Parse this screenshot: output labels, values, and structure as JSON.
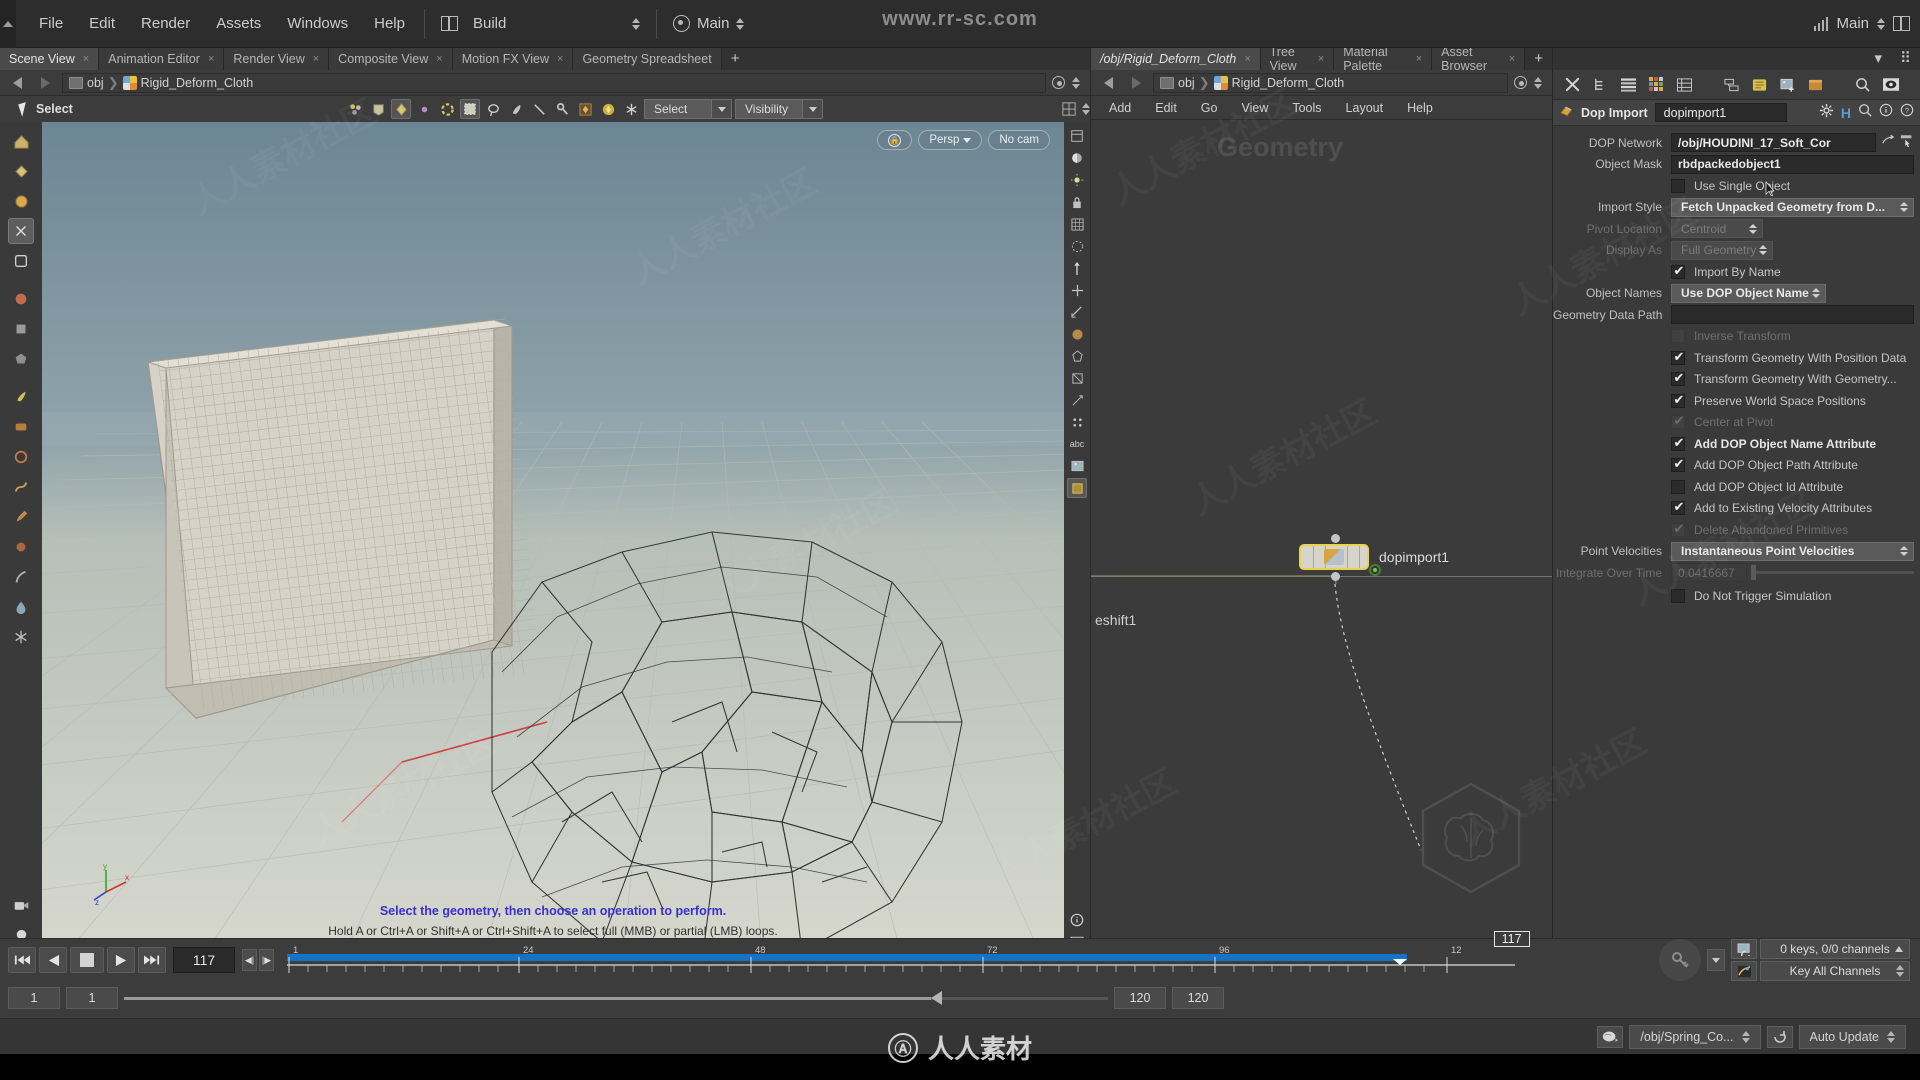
{
  "watermarks": {
    "top": "www.rr-sc.com",
    "bottom": "人人素材",
    "tile": "人人素材社区"
  },
  "menubar": {
    "items": [
      "File",
      "Edit",
      "Render",
      "Assets",
      "Windows",
      "Help"
    ],
    "desktop_label": "Build",
    "shelf_label": "Main",
    "right_label": "Main"
  },
  "scene_view": {
    "tabs": [
      {
        "label": "Scene View",
        "active": true,
        "closable": true
      },
      {
        "label": "Animation Editor",
        "active": false,
        "closable": true
      },
      {
        "label": "Render View",
        "active": false,
        "closable": true
      },
      {
        "label": "Composite View",
        "active": false,
        "closable": true
      },
      {
        "label": "Motion FX View",
        "active": false,
        "closable": true
      },
      {
        "label": "Geometry Spreadsheet",
        "active": false,
        "closable": true
      }
    ],
    "tab_add": "+",
    "path": {
      "root": "obj",
      "node": "Rigid_Deform_Cloth"
    },
    "toolbar": {
      "mode_label": "Select",
      "select_combo": "Select",
      "visibility_combo": "Visibility"
    },
    "badges": {
      "lock": "lock-icon",
      "view": "Persp",
      "camera": "No cam"
    },
    "hud": {
      "line1": "Select the geometry, then choose an operation to perform.",
      "line2": "Hold A or Ctrl+A or Shift+A or Ctrl+Shift+A to select full (MMB) or partial (LMB) loops."
    },
    "gnomon": {
      "x": "x",
      "y": "y",
      "z": "z"
    }
  },
  "network_editor": {
    "tabs": [
      {
        "label": "/obj/Rigid_Deform_Cloth",
        "active": true,
        "closable": true
      },
      {
        "label": "Tree View",
        "active": false,
        "closable": true
      },
      {
        "label": "Material Palette",
        "active": false,
        "closable": true
      },
      {
        "label": "Asset Browser",
        "active": false,
        "closable": true
      }
    ],
    "tab_add": "+",
    "path": {
      "root": "obj",
      "node": "Rigid_Deform_Cloth"
    },
    "menu": [
      "Add",
      "Edit",
      "Go",
      "View",
      "Tools",
      "Layout",
      "Help"
    ],
    "context_label": "Geometry",
    "nodes": [
      {
        "name": "dopimport1",
        "selected": true
      },
      {
        "name": "eshift1",
        "selected": false
      }
    ]
  },
  "parameters": {
    "node_type": "Dop Import",
    "node_name": "dopimport1",
    "rows": [
      {
        "kind": "field",
        "label": "DOP Network",
        "value": "/obj/HOUDINI_17_Soft_Cor",
        "dim": false
      },
      {
        "kind": "field",
        "label": "Object Mask",
        "value": "rbdpackedobject1",
        "dim": false
      },
      {
        "kind": "checkbox",
        "label": "Use Single Object",
        "checked": false,
        "dim": false
      },
      {
        "kind": "menu",
        "label": "Import Style",
        "value": "Fetch Unpacked Geometry from D...",
        "dim": false
      },
      {
        "kind": "menu",
        "label": "Pivot Location",
        "value": "Centroid",
        "dim": true
      },
      {
        "kind": "menu",
        "label": "Display As",
        "value": "Full Geometry",
        "dim": true
      },
      {
        "kind": "checkbox",
        "label": "Import By Name",
        "checked": true,
        "dim": false
      },
      {
        "kind": "menu",
        "label": "Object Names",
        "value": "Use DOP Object Name",
        "dim": false
      },
      {
        "kind": "field",
        "label": "Geometry Data Path",
        "value": "",
        "dim": false
      },
      {
        "kind": "checkbox",
        "label": "Inverse Transform",
        "checked": false,
        "dim": true
      },
      {
        "kind": "checkbox",
        "label": "Transform Geometry With Position Data",
        "checked": true,
        "dim": false
      },
      {
        "kind": "checkbox",
        "label": "Transform Geometry With Geometry...",
        "checked": true,
        "dim": false
      },
      {
        "kind": "checkbox",
        "label": "Preserve World Space Positions",
        "checked": true,
        "dim": false
      },
      {
        "kind": "checkbox",
        "label": "Center at Pivot",
        "checked": true,
        "dim": true
      },
      {
        "kind": "checkbox",
        "label": "Add DOP Object Name Attribute",
        "checked": true,
        "dim": false,
        "bold": true
      },
      {
        "kind": "checkbox",
        "label": "Add DOP Object Path Attribute",
        "checked": true,
        "dim": false
      },
      {
        "kind": "checkbox",
        "label": "Add DOP Object Id Attribute",
        "checked": false,
        "dim": false
      },
      {
        "kind": "checkbox",
        "label": "Add to Existing Velocity Attributes",
        "checked": true,
        "dim": false
      },
      {
        "kind": "checkbox",
        "label": "Delete Abandoned Primitives",
        "checked": true,
        "dim": true
      },
      {
        "kind": "menu",
        "label": "Point Velocities",
        "value": "Instantaneous Point Velocities",
        "dim": false
      },
      {
        "kind": "slider",
        "label": "Integrate Over Time",
        "value": "0.0416667",
        "dim": true
      },
      {
        "kind": "checkbox",
        "label": "Do Not Trigger Simulation",
        "checked": false,
        "dim": false
      }
    ]
  },
  "timeline": {
    "current_frame": "117",
    "playhead_label": "117",
    "range_start": "1",
    "range_end": "120",
    "global_end": "120",
    "field_left": "1",
    "field_right": "1",
    "ticks": [
      "1",
      "24",
      "48",
      "72",
      "96",
      "12"
    ],
    "keys_label": "0 keys, 0/0 channels",
    "key_mode": "Key All Channels"
  },
  "statusbar": {
    "cook_path": "/obj/Spring_Co...",
    "update_mode": "Auto Update"
  }
}
